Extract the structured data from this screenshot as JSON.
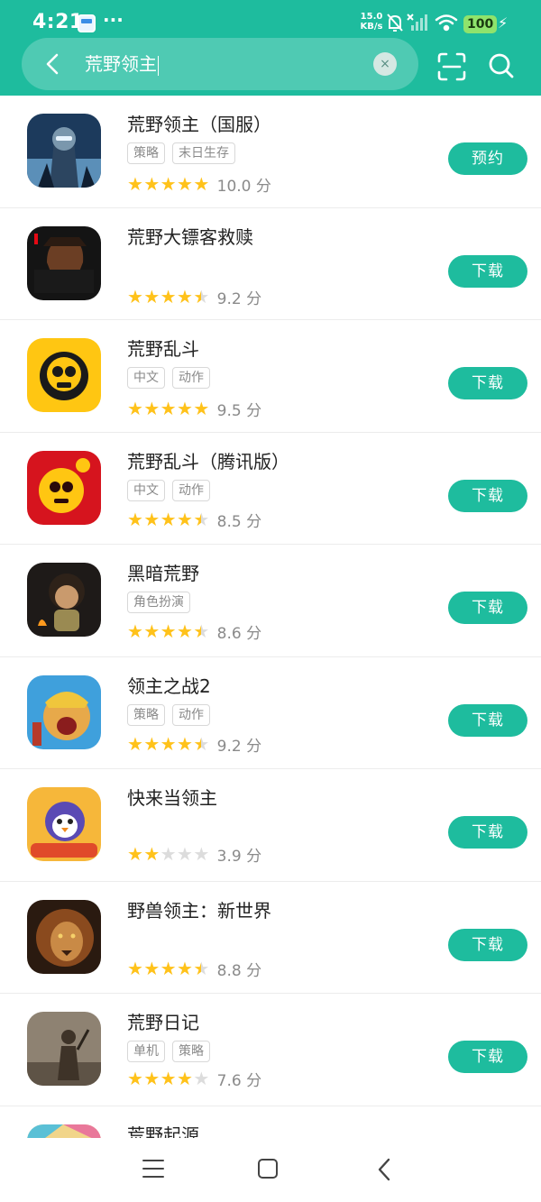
{
  "status_bar": {
    "time": "4:21",
    "more": "···",
    "net_speed_value": "15.0",
    "net_speed_unit": "KB/s",
    "battery": "100"
  },
  "search": {
    "query": "荒野领主",
    "clear_symbol": "×"
  },
  "colors": {
    "accent": "#1ebc9e",
    "star": "#ffc21a",
    "star_empty": "#dcdcdc",
    "battery": "#8fe36c"
  },
  "results": [
    {
      "name": "荒野领主（国服）",
      "tags": [
        "策略",
        "末日生存"
      ],
      "stars": 5,
      "score": "10.0 分",
      "action": "预约"
    },
    {
      "name": "荒野大镖客救赎",
      "tags": [],
      "stars": 4.5,
      "score": "9.2 分",
      "action": "下载"
    },
    {
      "name": "荒野乱斗",
      "tags": [
        "中文",
        "动作"
      ],
      "stars": 5,
      "score": "9.5 分",
      "action": "下载"
    },
    {
      "name": "荒野乱斗（腾讯版）",
      "tags": [
        "中文",
        "动作"
      ],
      "stars": 4.5,
      "score": "8.5 分",
      "action": "下载"
    },
    {
      "name": "黑暗荒野",
      "tags": [
        "角色扮演"
      ],
      "stars": 4.5,
      "score": "8.6 分",
      "action": "下载"
    },
    {
      "name": "领主之战2",
      "tags": [
        "策略",
        "动作"
      ],
      "stars": 4.5,
      "score": "9.2 分",
      "action": "下载"
    },
    {
      "name": "快来当领主",
      "tags": [],
      "stars": 2,
      "score": "3.9 分",
      "action": "下载"
    },
    {
      "name": "野兽领主：新世界",
      "tags": [],
      "stars": 4.5,
      "score": "8.8 分",
      "action": "下载"
    },
    {
      "name": "荒野日记",
      "tags": [
        "单机",
        "策略"
      ],
      "stars": 4,
      "score": "7.6 分",
      "action": "下载"
    },
    {
      "name": "荒野起源",
      "tags": [],
      "stars": null,
      "score": null,
      "action": null
    }
  ],
  "icon_names": [
    "back-arrow-icon",
    "clear-icon",
    "scan-icon",
    "search-icon",
    "menu-icon",
    "home-icon",
    "nav-back-icon"
  ]
}
